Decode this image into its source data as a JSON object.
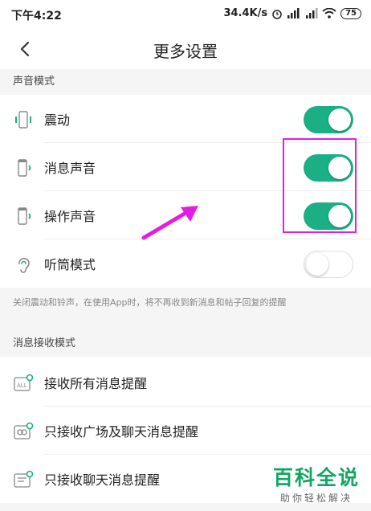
{
  "status_bar": {
    "time": "下午4:22",
    "network_speed": "34.4K/s",
    "battery_level": "75"
  },
  "nav": {
    "title": "更多设置"
  },
  "sound_mode": {
    "header": "声音模式",
    "items": [
      {
        "label": "震动",
        "enabled": true,
        "icon": "vibrate-icon"
      },
      {
        "label": "消息声音",
        "enabled": true,
        "icon": "phone-sound-icon"
      },
      {
        "label": "操作声音",
        "enabled": true,
        "icon": "phone-sound-icon"
      },
      {
        "label": "听筒模式",
        "enabled": false,
        "icon": "ear-icon"
      }
    ],
    "hint": "关闭震动和铃声，在使用App时，将不再收到新消息和帖子回复的提醒"
  },
  "receive_mode": {
    "header": "消息接收模式",
    "items": [
      {
        "label": "接收所有消息提醒",
        "icon": "all-messages-icon"
      },
      {
        "label": "只接收广场及聊天消息提醒",
        "icon": "square-chat-icon"
      },
      {
        "label": "只接收聊天消息提醒",
        "icon": "chat-only-icon"
      }
    ]
  },
  "watermark": {
    "title": "百科全说",
    "subtitle": "助你轻松解决"
  },
  "colors": {
    "accent": "#1aaf84",
    "annotation": "#e21ee2",
    "watermark": "#13a563"
  }
}
